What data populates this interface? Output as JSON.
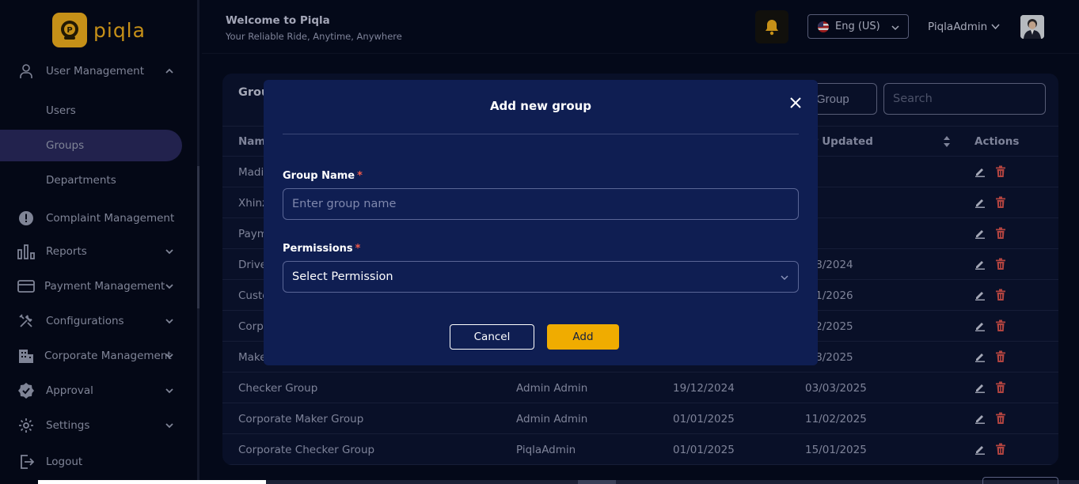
{
  "brand": {
    "name": "piqla",
    "accent": "#f2b01e"
  },
  "header": {
    "welcome": "Welcome to Piqla",
    "tagline": "Your Reliable Ride, Anytime, Anywhere",
    "language": "Eng (US)",
    "user_name": "PiqlaAdmin"
  },
  "sidebar": {
    "items": [
      {
        "label": "User Management",
        "icon": "user-icon",
        "expanded": true
      },
      {
        "label": "Users"
      },
      {
        "label": "Groups",
        "active": true
      },
      {
        "label": "Departments"
      },
      {
        "label": "Complaint Management",
        "icon": "alert-icon"
      },
      {
        "label": "Reports",
        "icon": "bar-chart-icon"
      },
      {
        "label": "Payment Management",
        "icon": "credit-card-icon"
      },
      {
        "label": "Configurations",
        "icon": "tools-icon"
      },
      {
        "label": "Corporate Management",
        "icon": "building-icon"
      },
      {
        "label": "Approval",
        "icon": "badge-check-icon"
      },
      {
        "label": "Settings",
        "icon": "gear-icon"
      },
      {
        "label": "Logout",
        "icon": "logout-icon"
      }
    ]
  },
  "card": {
    "title_partial": "Grou",
    "add_group_partial": "Group",
    "search_placeholder": "Search",
    "columns": {
      "name": "Nam",
      "last_updated": "st Updated",
      "actions": "Actions"
    },
    "rows": [
      {
        "name": "Madi",
        "created_by": "",
        "created": "",
        "updated": ""
      },
      {
        "name": "Xhinz",
        "created_by": "",
        "created": "",
        "updated": ""
      },
      {
        "name": "Paym",
        "created_by": "",
        "created": "",
        "updated": ""
      },
      {
        "name": "Drive",
        "created_by": "",
        "created": "",
        "updated": "/08/2024"
      },
      {
        "name": "Custo",
        "created_by": "",
        "created": "",
        "updated": "/01/2026"
      },
      {
        "name": "Corpo",
        "created_by": "",
        "created": "",
        "updated": "/02/2025"
      },
      {
        "name": "Make",
        "created_by": "",
        "created": "",
        "updated": "/08/2025"
      },
      {
        "name": "Checker Group",
        "created_by": "Admin Admin",
        "created": "19/12/2024",
        "updated": "03/03/2025"
      },
      {
        "name": "Corporate Maker Group",
        "created_by": "Admin Admin",
        "created": "01/01/2025",
        "updated": "11/02/2025"
      },
      {
        "name": "Corporate Checker Group",
        "created_by": "PiqlaAdmin",
        "created": "01/01/2025",
        "updated": "15/01/2025"
      }
    ]
  },
  "modal": {
    "title": "Add new group",
    "group_name_label": "Group Name",
    "required_mark": "*",
    "group_name_placeholder": "Enter group name",
    "permissions_label": "Permissions",
    "permissions_value": "Select Permission",
    "cancel_label": "Cancel",
    "add_label": "Add"
  }
}
